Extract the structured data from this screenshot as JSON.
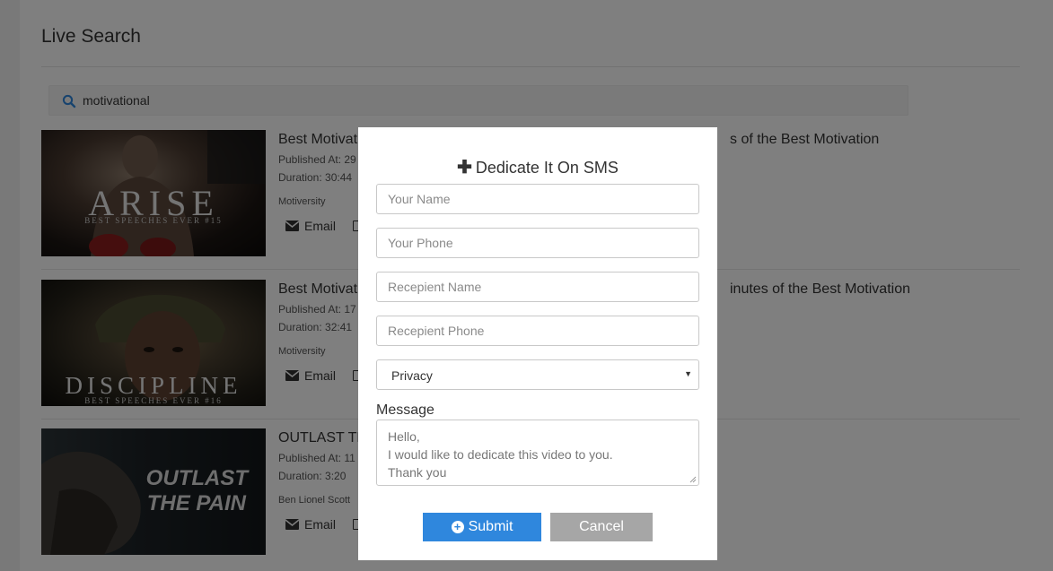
{
  "page": {
    "title": "Live Search",
    "search_icon": "search-icon",
    "search_value": "motivational"
  },
  "results": [
    {
      "title_left": "Best Motivat",
      "title_right": "s of the Best Motivation",
      "published": "Published At: 29",
      "duration": "Duration: 30:44",
      "channel": "Motiversity",
      "email_label": "Email",
      "thumb_title": "ARISE",
      "thumb_sub": "BEST SPEECHES EVER #15"
    },
    {
      "title_left": "Best Motivat",
      "title_right": "inutes of the Best Motivation",
      "published": "Published At: 17",
      "duration": "Duration: 32:41",
      "channel": "Motiversity",
      "email_label": "Email",
      "thumb_title": "DISCIPLINE",
      "thumb_sub": "BEST SPEECHES EVER #16"
    },
    {
      "title_left": "OUTLAST TH",
      "title_right": "",
      "published": "Published At: 11",
      "duration": "Duration: 3:20",
      "channel": "Ben Lionel Scott",
      "email_label": "Email",
      "thumb_title": "OUTLAST",
      "thumb_sub": "THE PAIN"
    }
  ],
  "modal": {
    "title_icon": "plus-icon",
    "title": "Dedicate It On SMS",
    "your_name_placeholder": "Your Name",
    "your_phone_placeholder": "Your Phone",
    "recipient_name_placeholder": "Recepient Name",
    "recipient_phone_placeholder": "Recepient Phone",
    "privacy_value": "Privacy",
    "message_label": "Message",
    "message_lines": [
      "Hello,",
      "I would like to dedicate this video to you.",
      "Thank you"
    ],
    "submit_label": "Submit",
    "cancel_label": "Cancel"
  },
  "colors": {
    "primary": "#2f87dd",
    "cancel": "#a6a6a6",
    "overlay": "rgba(0,0,0,0.5)"
  }
}
